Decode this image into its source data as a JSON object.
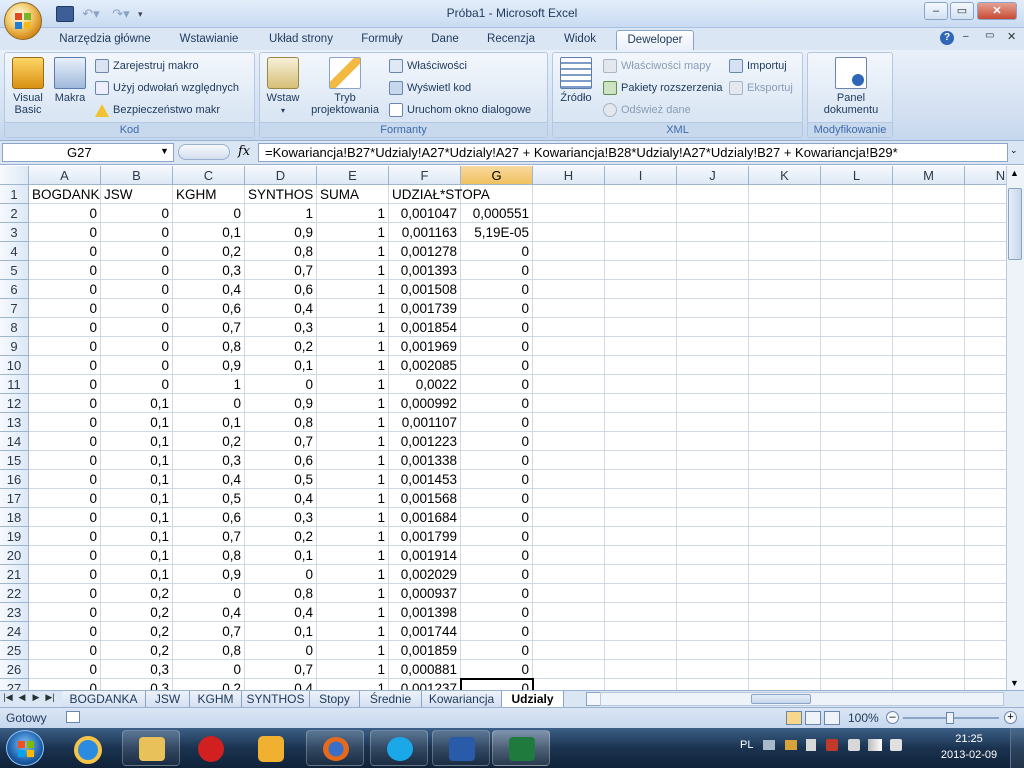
{
  "window": {
    "title": "Próba1 - Microsoft Excel"
  },
  "ribbon_tabs": [
    "Narzędzia główne",
    "Wstawianie",
    "Układ strony",
    "Formuły",
    "Dane",
    "Recenzja",
    "Widok",
    "Deweloper"
  ],
  "active_tab": "Deweloper",
  "ribbon": {
    "kod": {
      "label": "Kod",
      "visual_basic": "Visual Basic",
      "visual_basic_l1": "Visual",
      "visual_basic_l2": "Basic",
      "makra": "Makra",
      "zarejestruj": "Zarejestruj makro",
      "uzyj": "Użyj odwołań względnych",
      "bezpieczenstwo": "Bezpieczeństwo makr"
    },
    "formanty": {
      "label": "Formanty",
      "wstaw": "Wstaw",
      "tryb_l1": "Tryb",
      "tryb_l2": "projektowania",
      "wlasciwosci": "Właściwości",
      "wyswietl": "Wyświetl kod",
      "uruchom": "Uruchom okno dialogowe"
    },
    "xml": {
      "label": "XML",
      "zrodlo": "Źródło",
      "wlasciwosci_mapy": "Właściwości mapy",
      "pakiety": "Pakiety rozszerzenia",
      "odswiez": "Odśwież dane",
      "importuj": "Importuj",
      "eksportuj": "Eksportuj"
    },
    "modyfikowanie": {
      "label": "Modyfikowanie",
      "panel_l1": "Panel",
      "panel_l2": "dokumentu"
    }
  },
  "formula_bar": {
    "name_box": "G27",
    "fx": "fx",
    "formula": "=Kowariancja!B27*Udzialy!A27*Udzialy!A27 + Kowariancja!B28*Udzialy!A27*Udzialy!B27 + Kowariancja!B29*"
  },
  "columns": [
    "A",
    "B",
    "C",
    "D",
    "E",
    "F",
    "G",
    "H",
    "I",
    "J",
    "K",
    "L",
    "M",
    "N"
  ],
  "rows": [
    {
      "n": "1",
      "c": [
        "BOGDANKA",
        "JSW",
        "KGHM",
        "SYNTHOS",
        "SUMA",
        "UDZIAŁ*STOPA",
        ""
      ]
    },
    {
      "n": "2",
      "c": [
        "0",
        "0",
        "0",
        "1",
        "1",
        "0,001047",
        "0,000551"
      ]
    },
    {
      "n": "3",
      "c": [
        "0",
        "0",
        "0,1",
        "0,9",
        "1",
        "0,001163",
        "5,19E-05"
      ]
    },
    {
      "n": "4",
      "c": [
        "0",
        "0",
        "0,2",
        "0,8",
        "1",
        "0,001278",
        "0"
      ]
    },
    {
      "n": "5",
      "c": [
        "0",
        "0",
        "0,3",
        "0,7",
        "1",
        "0,001393",
        "0"
      ]
    },
    {
      "n": "6",
      "c": [
        "0",
        "0",
        "0,4",
        "0,6",
        "1",
        "0,001508",
        "0"
      ]
    },
    {
      "n": "7",
      "c": [
        "0",
        "0",
        "0,6",
        "0,4",
        "1",
        "0,001739",
        "0"
      ]
    },
    {
      "n": "8",
      "c": [
        "0",
        "0",
        "0,7",
        "0,3",
        "1",
        "0,001854",
        "0"
      ]
    },
    {
      "n": "9",
      "c": [
        "0",
        "0",
        "0,8",
        "0,2",
        "1",
        "0,001969",
        "0"
      ]
    },
    {
      "n": "10",
      "c": [
        "0",
        "0",
        "0,9",
        "0,1",
        "1",
        "0,002085",
        "0"
      ]
    },
    {
      "n": "11",
      "c": [
        "0",
        "0",
        "1",
        "0",
        "1",
        "0,0022",
        "0"
      ]
    },
    {
      "n": "12",
      "c": [
        "0",
        "0,1",
        "0",
        "0,9",
        "1",
        "0,000992",
        "0"
      ]
    },
    {
      "n": "13",
      "c": [
        "0",
        "0,1",
        "0,1",
        "0,8",
        "1",
        "0,001107",
        "0"
      ]
    },
    {
      "n": "14",
      "c": [
        "0",
        "0,1",
        "0,2",
        "0,7",
        "1",
        "0,001223",
        "0"
      ]
    },
    {
      "n": "15",
      "c": [
        "0",
        "0,1",
        "0,3",
        "0,6",
        "1",
        "0,001338",
        "0"
      ]
    },
    {
      "n": "16",
      "c": [
        "0",
        "0,1",
        "0,4",
        "0,5",
        "1",
        "0,001453",
        "0"
      ]
    },
    {
      "n": "17",
      "c": [
        "0",
        "0,1",
        "0,5",
        "0,4",
        "1",
        "0,001568",
        "0"
      ]
    },
    {
      "n": "18",
      "c": [
        "0",
        "0,1",
        "0,6",
        "0,3",
        "1",
        "0,001684",
        "0"
      ]
    },
    {
      "n": "19",
      "c": [
        "0",
        "0,1",
        "0,7",
        "0,2",
        "1",
        "0,001799",
        "0"
      ]
    },
    {
      "n": "20",
      "c": [
        "0",
        "0,1",
        "0,8",
        "0,1",
        "1",
        "0,001914",
        "0"
      ]
    },
    {
      "n": "21",
      "c": [
        "0",
        "0,1",
        "0,9",
        "0",
        "1",
        "0,002029",
        "0"
      ]
    },
    {
      "n": "22",
      "c": [
        "0",
        "0,2",
        "0",
        "0,8",
        "1",
        "0,000937",
        "0"
      ]
    },
    {
      "n": "23",
      "c": [
        "0",
        "0,2",
        "0,4",
        "0,4",
        "1",
        "0,001398",
        "0"
      ]
    },
    {
      "n": "24",
      "c": [
        "0",
        "0,2",
        "0,7",
        "0,1",
        "1",
        "0,001744",
        "0"
      ]
    },
    {
      "n": "25",
      "c": [
        "0",
        "0,2",
        "0,8",
        "0",
        "1",
        "0,001859",
        "0"
      ]
    },
    {
      "n": "26",
      "c": [
        "0",
        "0,3",
        "0",
        "0,7",
        "1",
        "0,000881",
        "0"
      ]
    },
    {
      "n": "27",
      "c": [
        "0",
        "0,3",
        "0,2",
        "0,4",
        "1",
        "0,001237",
        "0"
      ]
    }
  ],
  "sheet_tabs": [
    "BOGDANKA",
    "JSW",
    "KGHM",
    "SYNTHOS",
    "Stopy",
    "Średnie",
    "Kowariancja",
    "Udzialy"
  ],
  "active_sheet": "Udzialy",
  "status": {
    "ready": "Gotowy",
    "zoom": "100%"
  },
  "taskbar": {
    "lang": "PL",
    "time": "21:25",
    "date": "2013-02-09"
  }
}
